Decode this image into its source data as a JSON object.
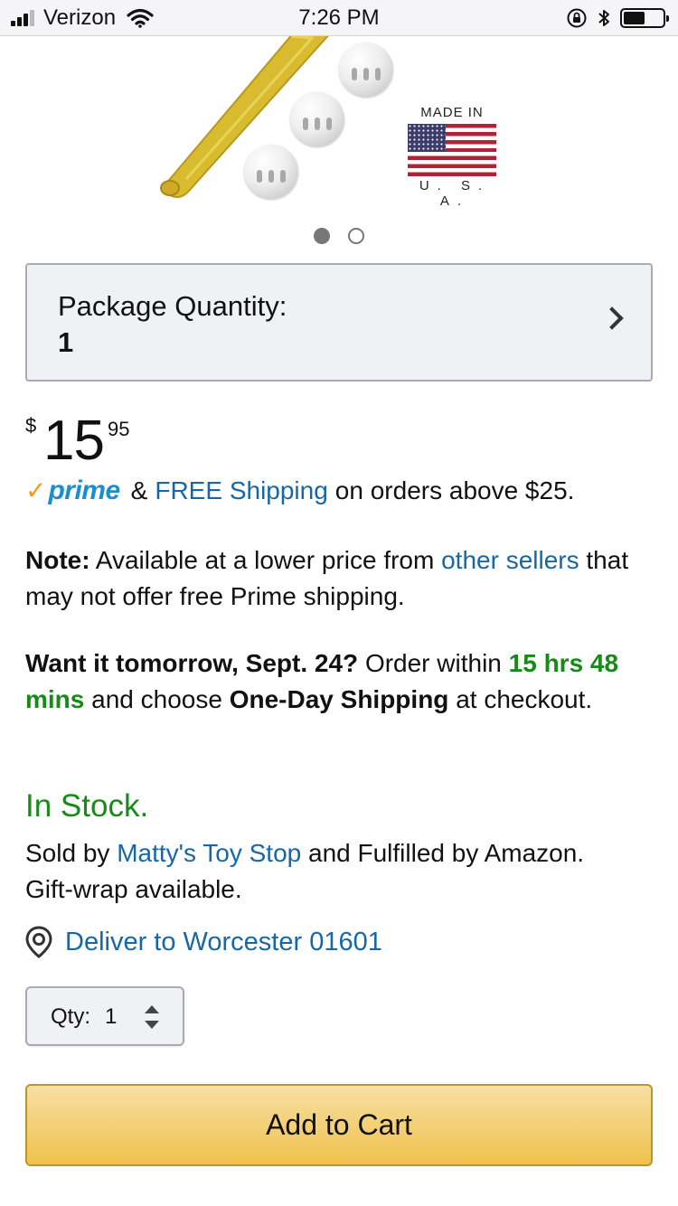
{
  "status_bar": {
    "carrier": "Verizon",
    "time": "7:26 PM",
    "signal_bars_active": 3,
    "signal_bars_total": 4,
    "battery_level": 0.55,
    "icons": [
      "signal-icon",
      "wifi-icon",
      "orientation-lock-icon",
      "bluetooth-icon",
      "battery-icon"
    ]
  },
  "product_image": {
    "badge_top": "MADE IN",
    "badge_bottom": "U. S. A.",
    "carousel": {
      "total": 2,
      "active_index": 0
    }
  },
  "package_quantity": {
    "label": "Package Quantity:",
    "value": "1"
  },
  "price": {
    "symbol": "$",
    "whole": "15",
    "fraction": "95"
  },
  "shipping": {
    "prime_check": "✓",
    "prime_word": "prime",
    "amp": "&",
    "free_shipping_link": "FREE Shipping",
    "condition": "on orders above $25."
  },
  "note": {
    "label": "Note:",
    "text_before_link": "Available at a lower price from",
    "link": "other sellers",
    "text_after_link": "that may not offer free Prime shipping."
  },
  "delivery_promo": {
    "headline": "Want it tomorrow, Sept. 24?",
    "order_within": "Order within",
    "countdown": "15 hrs 48 mins",
    "and_choose": "and choose",
    "method": "One-Day Shipping",
    "suffix": "at checkout."
  },
  "availability": {
    "status": "In Stock.",
    "sold_by_prefix": "Sold by",
    "seller": "Matty's Toy Stop",
    "fulfilled": "and Fulfilled by Amazon.",
    "gift_wrap": "Gift-wrap available."
  },
  "deliver_to": {
    "text": "Deliver to Worcester 01601"
  },
  "quantity": {
    "label": "Qty:",
    "value": "1"
  },
  "cart": {
    "button_label": "Add to Cart"
  },
  "colors": {
    "link": "#1667a8",
    "in_stock_green": "#188a18",
    "prime_blue": "#1b8fcd",
    "prime_check_orange": "#f49a1a",
    "cart_button": "#f0c14b"
  }
}
